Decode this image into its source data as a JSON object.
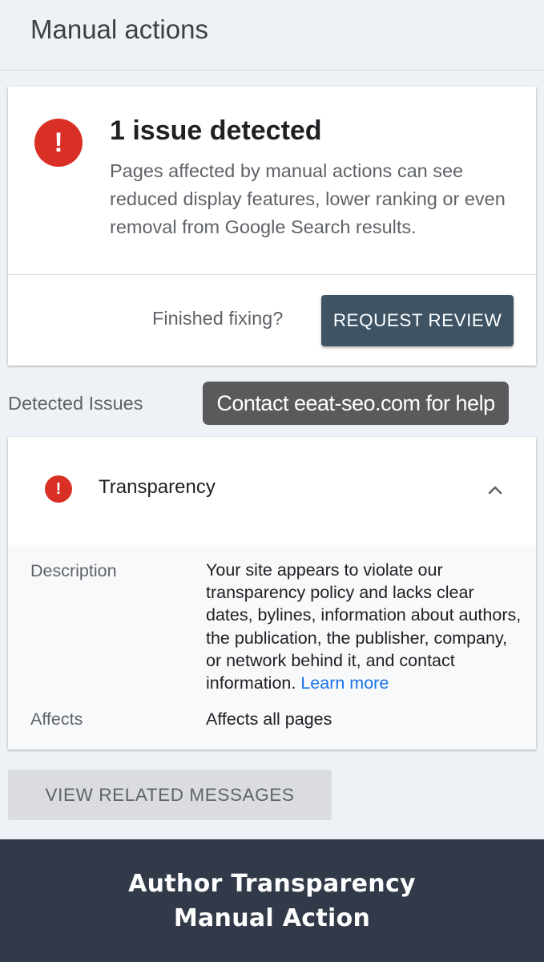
{
  "header": {
    "title": "Manual actions"
  },
  "summary": {
    "icon": "error-icon",
    "icon_glyph": "!",
    "title": "1 issue detected",
    "description": "Pages affected by manual actions can see reduced display features, lower ranking or even removal from Google Search results.",
    "finished_label": "Finished fixing?",
    "request_review_label": "REQUEST REVIEW"
  },
  "detected": {
    "section_label": "Detected Issues",
    "overlay_text": "Contact eeat-seo.com for help"
  },
  "issue": {
    "icon": "error-icon",
    "icon_glyph": "!",
    "name": "Transparency",
    "expanded": true,
    "description_label": "Description",
    "description_text": "Your site appears to violate our transparency policy and lacks clear dates, bylines, information about authors, the publication, the publisher, company, or network behind it, and contact information.",
    "learn_more": "Learn more",
    "affects_label": "Affects",
    "affects_value": "Affects all pages"
  },
  "related_button_label": "VIEW RELATED MESSAGES",
  "footer": {
    "line1": "Author Transparency",
    "line2": "Manual Action"
  },
  "colors": {
    "error": "#d93025",
    "primary_button": "#3e5464",
    "link": "#1a73e8",
    "footer_bg": "#323a4a"
  }
}
